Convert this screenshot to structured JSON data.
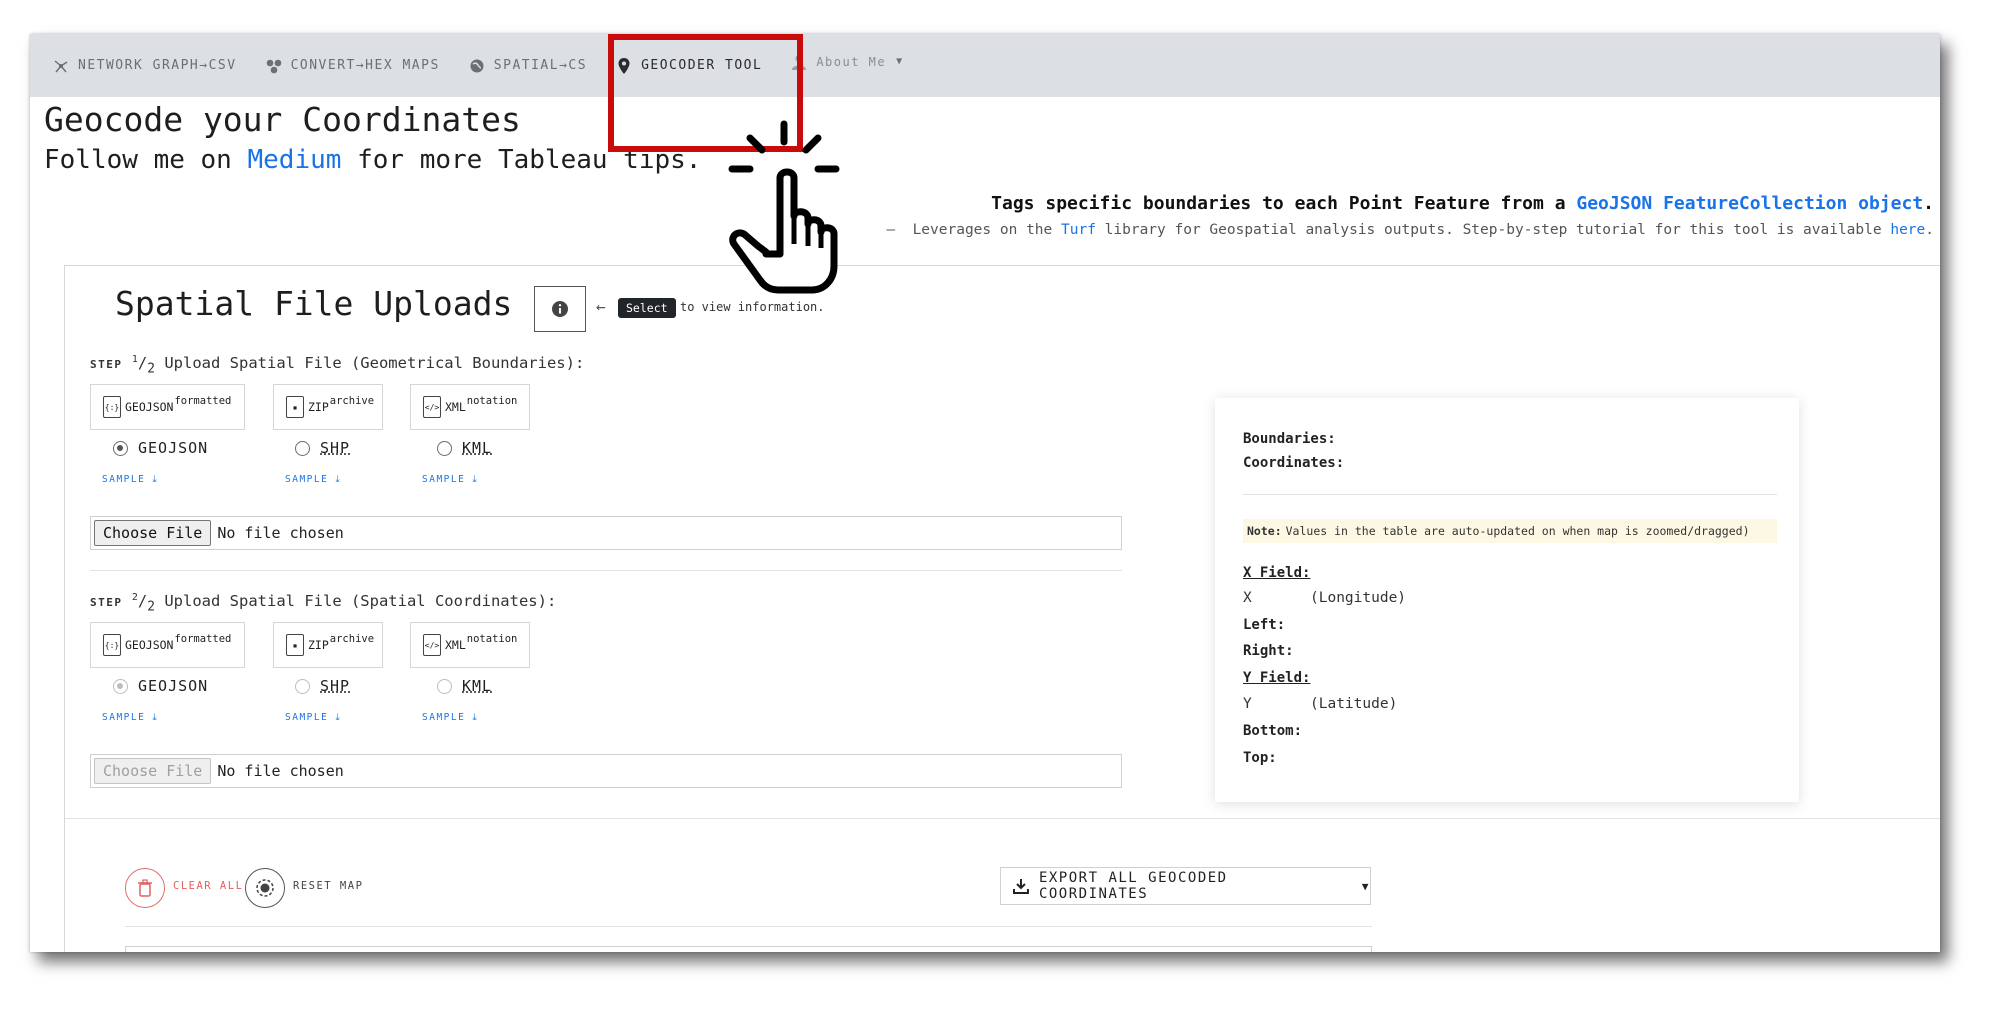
{
  "nav": {
    "items": [
      {
        "label": "NETWORK GRAPH→CSV",
        "icon": "network-icon"
      },
      {
        "label": "CONVERT→HEX MAPS",
        "icon": "hex-map-icon"
      },
      {
        "label": "SPATIAL→CS",
        "icon": "globe-icon"
      },
      {
        "label": "GEOCODER TOOL",
        "icon": "map-pin-icon"
      },
      {
        "label": "About Me",
        "icon": "user-icon"
      }
    ],
    "active": "GEOCODER TOOL",
    "highlight_color": "#c80b0b"
  },
  "header": {
    "title": "Geocode your Coordinates",
    "follow_prefix": "Follow me on",
    "follow_link": "Medium",
    "follow_suffix": "for more Tableau tips.",
    "tagline_prefix": "Tags specific boundaries to each Point Feature from a",
    "tagline_link": "GeoJSON FeatureCollection object",
    "tagline_suffix": ".",
    "sub_dash": "—",
    "sub_prefix": "Leverages on the",
    "sub_link1": "Turf",
    "sub_middle": "library for Geospatial analysis outputs. Step-by-step tutorial for this tool is available",
    "sub_link2": "here",
    "sub_suffix": "."
  },
  "uploads": {
    "title": "Spatial File Uploads",
    "arrow": "←",
    "select_label": "Select",
    "view_info": "to view information.",
    "step1": {
      "step": "STEP",
      "num": "1",
      "den": "2",
      "text": "Upload Spatial File (Geometrical Boundaries):"
    },
    "step2": {
      "step": "STEP",
      "num": "2",
      "den": "2",
      "text": "Upload Spatial File (Spatial Coordinates):"
    },
    "formats": [
      {
        "name": "GEOJSON",
        "sup": "formatted",
        "radio": "GEOJSON"
      },
      {
        "name": "ZIP",
        "sup": "archive",
        "radio": "SHP"
      },
      {
        "name": "XML",
        "sup": "notation",
        "radio": "KML"
      }
    ],
    "sample": "SAMPLE",
    "choose_file": "Choose File",
    "no_file": "No file chosen"
  },
  "info_card": {
    "boundaries": "Boundaries:",
    "coordinates": "Coordinates:",
    "note_label": "Note:",
    "note_text": "Values in the table are auto-updated on when map is zoomed/dragged)",
    "x_field": "X Field:",
    "x": "X",
    "x_desc": "(Longitude)",
    "left": "Left:",
    "right": "Right:",
    "y_field": "Y Field:",
    "y": "Y",
    "y_desc": "(Latitude)",
    "bottom": "Bottom:",
    "top": "Top:"
  },
  "actions": {
    "clear_all": "CLEAR ALL",
    "reset_map": "RESET MAP",
    "export": "EXPORT ALL GEOCODED COORDINATES"
  },
  "colors": {
    "link": "#1a73e8",
    "clear": "#e06060"
  }
}
